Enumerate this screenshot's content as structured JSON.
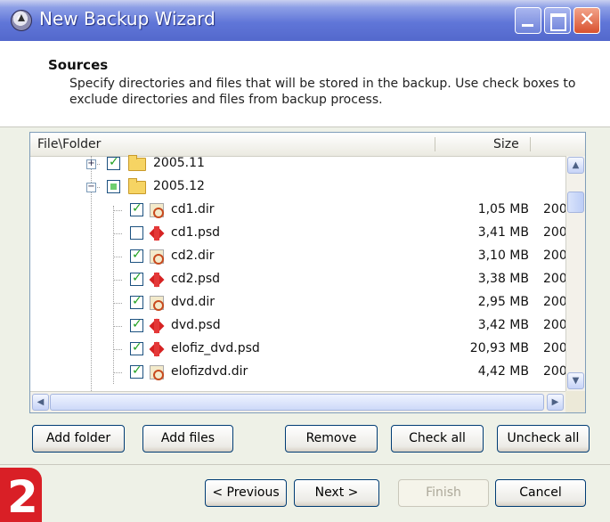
{
  "window": {
    "title": "New Backup Wizard"
  },
  "header": {
    "title": "Sources",
    "description": "Specify directories and files that will be stored in the backup. Use check boxes to exclude directories and files from backup process."
  },
  "file_list": {
    "columns": {
      "file_folder": "File\\Folder",
      "size": "Size"
    },
    "rows": [
      {
        "name": "2005.11",
        "kind": "folder",
        "checked": "checked",
        "expander": "+",
        "size": "",
        "date": ""
      },
      {
        "name": "2005.12",
        "kind": "folder",
        "checked": "partial",
        "expander": "-",
        "size": "",
        "date": ""
      },
      {
        "name": "cd1.dir",
        "kind": "dir-file",
        "checked": "checked",
        "size": "1,05 MB",
        "date": "200"
      },
      {
        "name": "cd1.psd",
        "kind": "psd-file",
        "checked": "unchecked",
        "size": "3,41 MB",
        "date": "200"
      },
      {
        "name": "cd2.dir",
        "kind": "dir-file",
        "checked": "checked",
        "size": "3,10 MB",
        "date": "200"
      },
      {
        "name": "cd2.psd",
        "kind": "psd-file",
        "checked": "checked",
        "size": "3,38 MB",
        "date": "200"
      },
      {
        "name": "dvd.dir",
        "kind": "dir-file",
        "checked": "checked",
        "size": "2,95 MB",
        "date": "200"
      },
      {
        "name": "dvd.psd",
        "kind": "psd-file",
        "checked": "checked",
        "size": "3,42 MB",
        "date": "200"
      },
      {
        "name": "elofiz_dvd.psd",
        "kind": "psd-file",
        "checked": "checked",
        "size": "20,93 MB",
        "date": "200"
      },
      {
        "name": "elofizdvd.dir",
        "kind": "dir-file",
        "checked": "checked",
        "size": "4,42 MB",
        "date": "200"
      }
    ]
  },
  "actions": {
    "add_folder": "Add folder",
    "add_files": "Add files",
    "remove": "Remove",
    "check_all": "Check all",
    "uncheck_all": "Uncheck all"
  },
  "navigation": {
    "previous": "< Previous",
    "next": "Next >",
    "finish": "Finish",
    "cancel": "Cancel"
  },
  "badge": {
    "number": "2"
  },
  "colors": {
    "titlebar": "#5368cc",
    "badge": "#d91f26",
    "check": "#21a121"
  }
}
